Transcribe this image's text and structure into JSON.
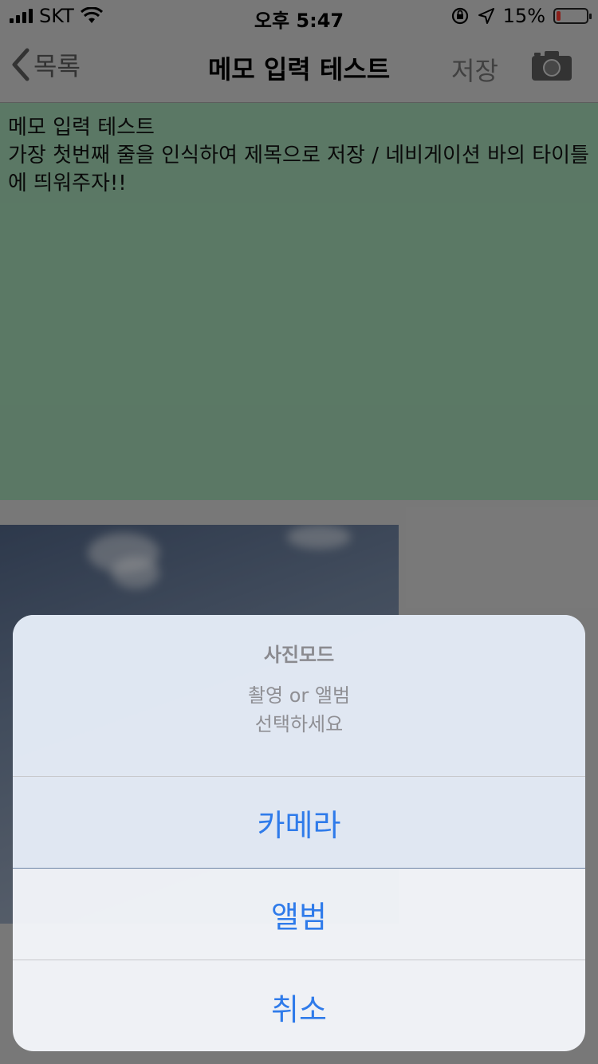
{
  "status_bar": {
    "carrier": "SKT",
    "time": "오후 5:47",
    "battery_percent": "15%",
    "battery_level": 0.15,
    "icons": [
      "signal-icon",
      "wifi-icon",
      "orientation-lock-icon",
      "location-icon",
      "battery-icon"
    ]
  },
  "nav": {
    "back_label": "목록",
    "title": "메모 입력 테스트",
    "save_label": "저장",
    "camera_icon": "camera-icon"
  },
  "memo": {
    "text": "메모 입력 테스트\n가장 첫번째 줄을 인식하여 제목으로 저장 / 네비게이션 바의 타이틀에 띄워주자!!",
    "background": "#98c9a9"
  },
  "action_sheet": {
    "title": "사진모드",
    "message_line1": "촬영 or 앨범",
    "message_line2": "선택하세요",
    "actions": [
      {
        "label": "카메라"
      },
      {
        "label": "앨범"
      },
      {
        "label": "취소"
      }
    ],
    "accent": "#2f7bea"
  }
}
